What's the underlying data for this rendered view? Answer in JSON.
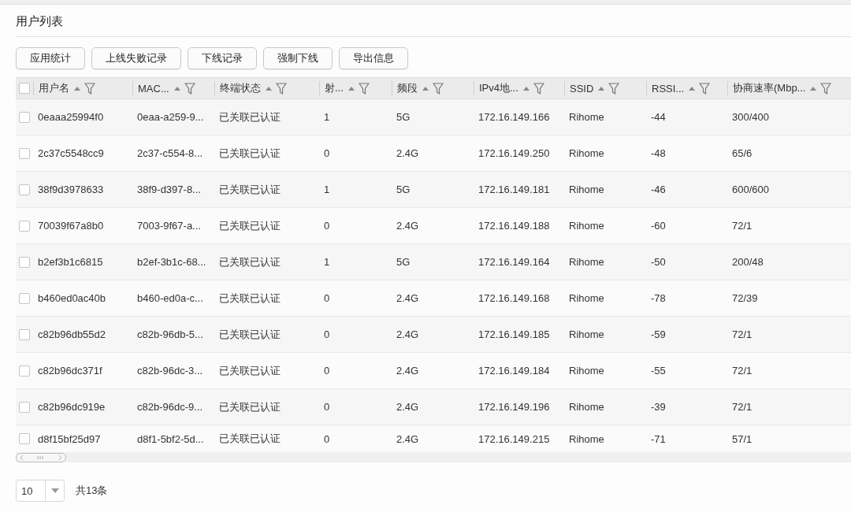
{
  "panel": {
    "title": "用户列表"
  },
  "toolbar": {
    "buttons": [
      "应用统计",
      "上线失败记录",
      "下线记录",
      "强制下线",
      "导出信息"
    ]
  },
  "table": {
    "select_all": {
      "checked": false
    },
    "columns": [
      {
        "label": "用户名"
      },
      {
        "label": "MAC..."
      },
      {
        "label": "终端状态"
      },
      {
        "label": "射..."
      },
      {
        "label": "频段"
      },
      {
        "label": "IPv4地..."
      },
      {
        "label": "SSID"
      },
      {
        "label": "RSSI..."
      },
      {
        "label": "协商速率(Mbp..."
      }
    ],
    "rows": [
      {
        "checked": false,
        "cells": [
          "0eaaa25994f0",
          "0eaa-a259-9...",
          "已关联已认证",
          "1",
          "5G",
          "172.16.149.166",
          "Rihome",
          "-44",
          "300/400"
        ]
      },
      {
        "checked": false,
        "cells": [
          "2c37c5548cc9",
          "2c37-c554-8...",
          "已关联已认证",
          "0",
          "2.4G",
          "172.16.149.250",
          "Rihome",
          "-48",
          "65/6"
        ]
      },
      {
        "checked": false,
        "cells": [
          "38f9d3978633",
          "38f9-d397-8...",
          "已关联已认证",
          "1",
          "5G",
          "172.16.149.181",
          "Rihome",
          "-46",
          "600/600"
        ]
      },
      {
        "checked": false,
        "cells": [
          "70039f67a8b0",
          "7003-9f67-a...",
          "已关联已认证",
          "0",
          "2.4G",
          "172.16.149.188",
          "Rihome",
          "-60",
          "72/1"
        ]
      },
      {
        "checked": false,
        "cells": [
          "b2ef3b1c6815",
          "b2ef-3b1c-68...",
          "已关联已认证",
          "1",
          "5G",
          "172.16.149.164",
          "Rihome",
          "-50",
          "200/48"
        ]
      },
      {
        "checked": false,
        "cells": [
          "b460ed0ac40b",
          "b460-ed0a-c...",
          "已关联已认证",
          "0",
          "2.4G",
          "172.16.149.168",
          "Rihome",
          "-78",
          "72/39"
        ]
      },
      {
        "checked": false,
        "cells": [
          "c82b96db55d2",
          "c82b-96db-5...",
          "已关联已认证",
          "0",
          "2.4G",
          "172.16.149.185",
          "Rihome",
          "-59",
          "72/1"
        ]
      },
      {
        "checked": false,
        "cells": [
          "c82b96dc371f",
          "c82b-96dc-3...",
          "已关联已认证",
          "0",
          "2.4G",
          "172.16.149.184",
          "Rihome",
          "-55",
          "72/1"
        ]
      },
      {
        "checked": false,
        "cells": [
          "c82b96dc919e",
          "c82b-96dc-9...",
          "已关联已认证",
          "0",
          "2.4G",
          "172.16.149.196",
          "Rihome",
          "-39",
          "72/1"
        ]
      },
      {
        "checked": false,
        "cells": [
          "d8f15bf25d97",
          "d8f1-5bf2-5d...",
          "已关联已认证",
          "0",
          "2.4G",
          "172.16.149.215",
          "Rihome",
          "-71",
          "57/1"
        ]
      }
    ]
  },
  "pagination": {
    "page_size": "10",
    "total": "共13条"
  }
}
